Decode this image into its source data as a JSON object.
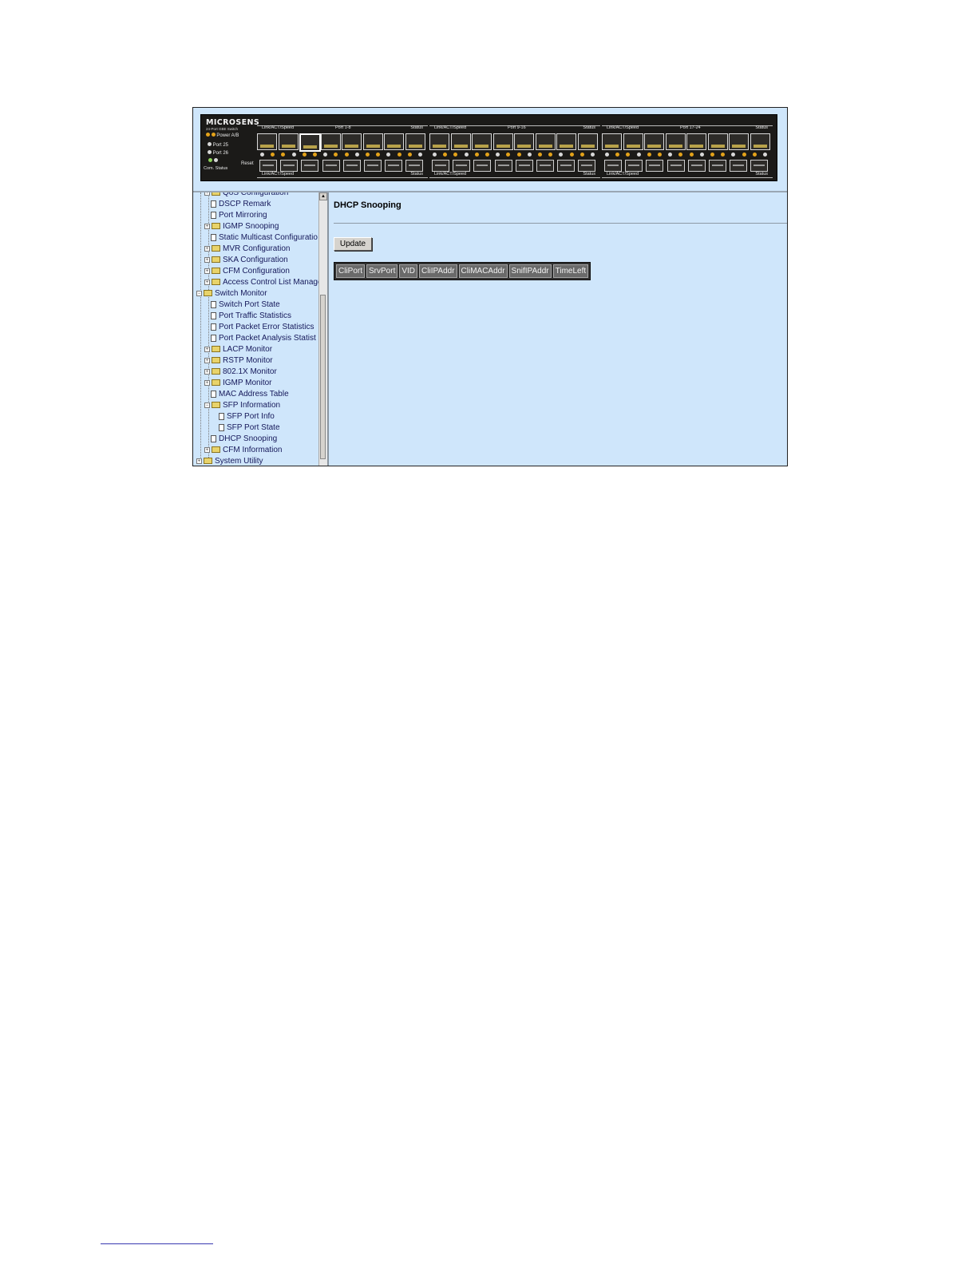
{
  "device": {
    "brand": "MICROSENS",
    "model": "24-Port GBE Switch",
    "power_label": "Power A/B",
    "port25_label": "Port 25",
    "port26_label": "Port 26",
    "com_status_label": "Com. Status",
    "reset_label": "Reset",
    "groups": [
      {
        "top_left": "Link/ACT/Speed",
        "top_mid": "Port 1-8",
        "top_right": "Status",
        "bot_left": "Link/ACT/Speed",
        "bot_right": "Status"
      },
      {
        "top_left": "Link/ACT/Speed",
        "top_mid": "Port 9-16",
        "top_right": "Status",
        "bot_left": "Link/ACT/Speed",
        "bot_right": "Status"
      },
      {
        "top_left": "Link/ACT/Speed",
        "top_mid": "Port 17-24",
        "top_right": "Status",
        "bot_left": "Link/ACT/Speed",
        "bot_right": "Status"
      }
    ]
  },
  "tree": {
    "items": [
      {
        "label": "QoS Configuration",
        "type": "folder"
      },
      {
        "label": "DSCP Remark",
        "type": "file"
      },
      {
        "label": "Port Mirroring",
        "type": "file"
      },
      {
        "label": "IGMP Snooping",
        "type": "folder"
      },
      {
        "label": "Static Multicast Configuratio",
        "type": "file"
      },
      {
        "label": "MVR Configuration",
        "type": "folder"
      },
      {
        "label": "SKA Configuration",
        "type": "folder"
      },
      {
        "label": "CFM Configuration",
        "type": "folder"
      },
      {
        "label": "Access Control List Manage",
        "type": "folder"
      },
      {
        "label": "Switch Monitor",
        "type": "folder-open"
      },
      {
        "label": "Switch Port State",
        "type": "file"
      },
      {
        "label": "Port Traffic Statistics",
        "type": "file"
      },
      {
        "label": "Port Packet Error Statistics",
        "type": "file"
      },
      {
        "label": "Port Packet Analysis Statist",
        "type": "file"
      },
      {
        "label": "LACP Monitor",
        "type": "folder"
      },
      {
        "label": "RSTP Monitor",
        "type": "folder"
      },
      {
        "label": "802.1X Monitor",
        "type": "folder"
      },
      {
        "label": "IGMP Monitor",
        "type": "folder"
      },
      {
        "label": "MAC Address Table",
        "type": "file"
      },
      {
        "label": "SFP Information",
        "type": "folder-open"
      },
      {
        "label": "SFP Port Info",
        "type": "file"
      },
      {
        "label": "SFP Port State",
        "type": "file"
      },
      {
        "label": "DHCP Snooping",
        "type": "file"
      },
      {
        "label": "CFM Information",
        "type": "folder"
      },
      {
        "label": "System Utility",
        "type": "folder"
      }
    ]
  },
  "main": {
    "title": "DHCP Snooping",
    "update_label": "Update",
    "columns": [
      "CliPort",
      "SrvPort",
      "VID",
      "CliIPAddr",
      "CliMACAddr",
      "SnifIPAddr",
      "TimeLeft"
    ]
  },
  "colors": {
    "page_bg": "#cfe6fb",
    "device_bg": "#1b1a18",
    "table_header_bg": "#6a6a6a"
  }
}
